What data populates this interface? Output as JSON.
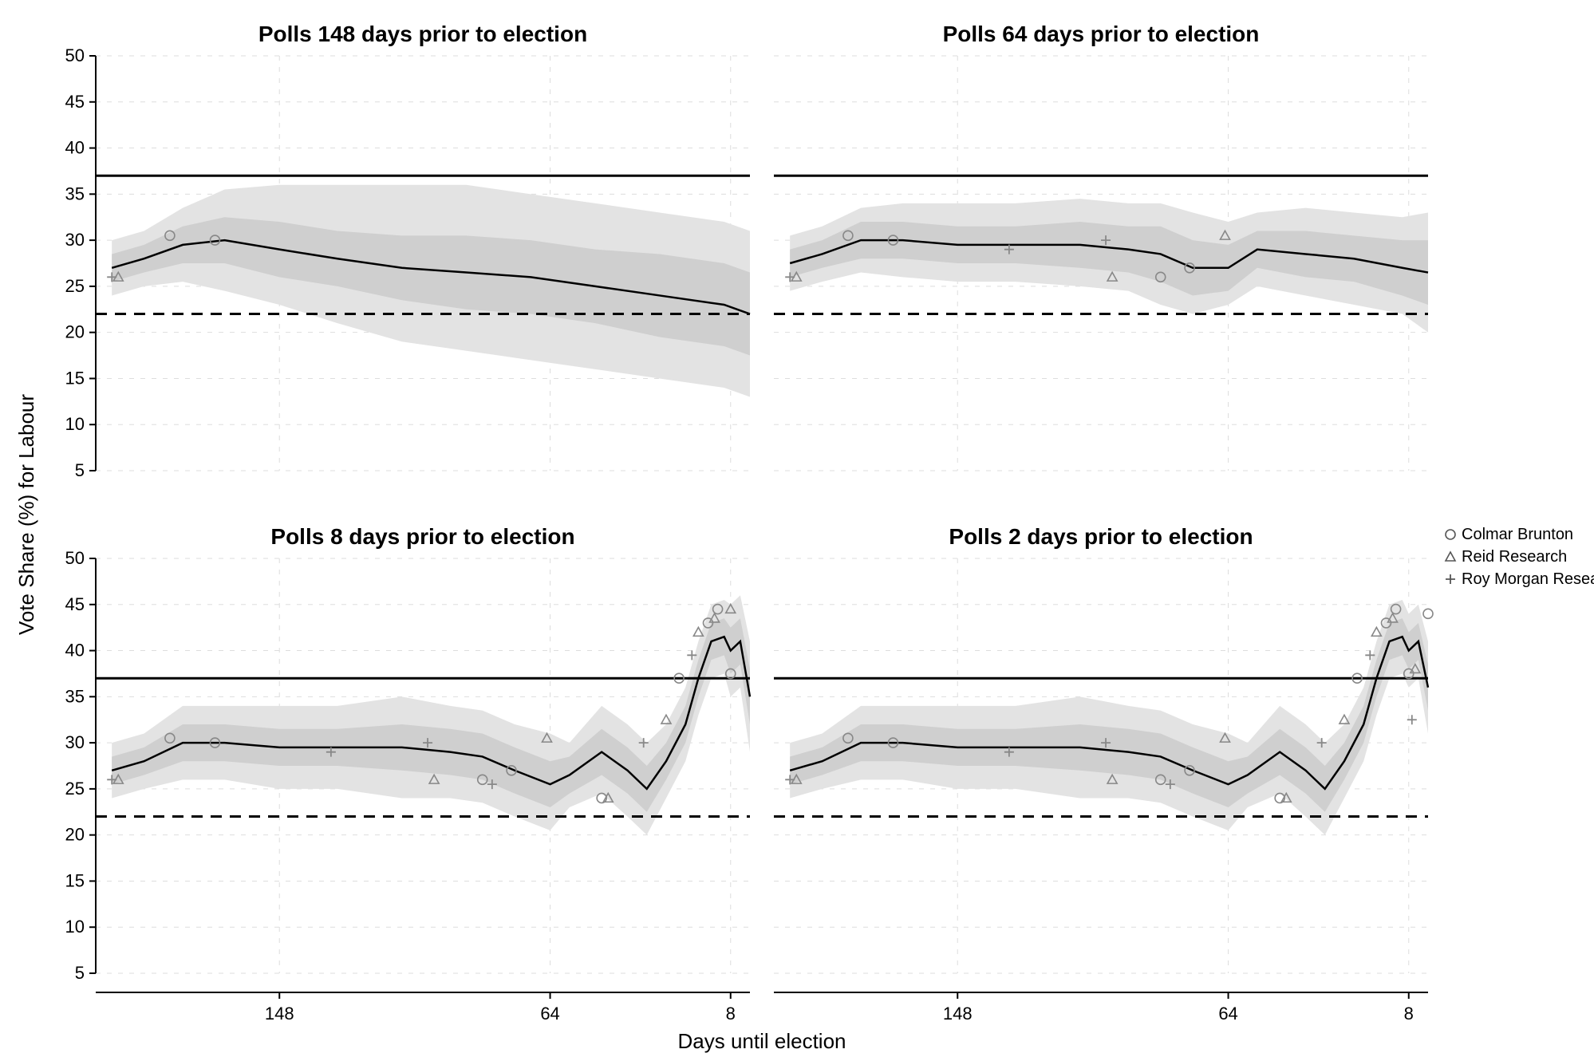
{
  "chart_data": {
    "type": "line",
    "ylabel": "Vote Share (%) for Labour",
    "xlabel": "Days until election",
    "y_ticks": [
      5,
      10,
      15,
      20,
      25,
      30,
      35,
      40,
      45,
      50
    ],
    "x_ticks": [
      148,
      64,
      8
    ],
    "ylim": [
      5,
      50
    ],
    "ref_lines": {
      "solid": 37,
      "dashed": 22
    },
    "legend": {
      "items": [
        "Colmar Brunton",
        "Reid Research",
        "Roy Morgan Research"
      ],
      "symbols": [
        "circle",
        "triangle",
        "plus"
      ]
    },
    "panels": [
      {
        "title": "Polls 148 days prior to election",
        "series": {
          "x": [
            200,
            190,
            178,
            165,
            148,
            130,
            110,
            90,
            70,
            50,
            30,
            10,
            2
          ],
          "mean": [
            27,
            28,
            29.5,
            30,
            29,
            28,
            27,
            26.5,
            26,
            25,
            24,
            23,
            22
          ],
          "lo50": [
            25.5,
            26.5,
            27.5,
            27.5,
            26,
            25,
            23.5,
            22.5,
            22,
            21,
            19.5,
            18.5,
            17.5
          ],
          "hi50": [
            28.5,
            29.5,
            31.5,
            32.5,
            32,
            31,
            30.5,
            30.5,
            30,
            29,
            28.5,
            27.5,
            26.5
          ],
          "lo90": [
            24,
            25,
            25.5,
            24.5,
            23,
            21,
            19,
            18,
            17,
            16,
            15,
            14,
            13
          ],
          "hi90": [
            30,
            31,
            33.5,
            35.5,
            36,
            36,
            36,
            36,
            35,
            34,
            33,
            32,
            31
          ]
        },
        "points": [
          {
            "sym": "plus",
            "x": 200,
            "y": 26
          },
          {
            "sym": "triangle",
            "x": 198,
            "y": 26
          },
          {
            "sym": "circle",
            "x": 182,
            "y": 30.5
          },
          {
            "sym": "circle",
            "x": 168,
            "y": 30
          }
        ]
      },
      {
        "title": "Polls 64 days prior to election",
        "series": {
          "x": [
            200,
            190,
            178,
            165,
            148,
            130,
            110,
            95,
            85,
            75,
            64,
            55,
            40,
            25,
            10,
            2
          ],
          "mean": [
            27.5,
            28.5,
            30,
            30,
            29.5,
            29.5,
            29.5,
            29,
            28.5,
            27,
            27,
            29,
            28.5,
            28,
            27,
            26.5
          ],
          "lo50": [
            26,
            27,
            28,
            28,
            27.5,
            27.5,
            27,
            26.5,
            25.5,
            24,
            24.5,
            27,
            26,
            25.5,
            24,
            23
          ],
          "hi50": [
            29,
            30,
            32,
            32,
            31.5,
            31.5,
            32,
            31.5,
            31.5,
            30,
            29.5,
            31,
            31,
            30.5,
            30,
            30
          ],
          "lo90": [
            24.5,
            25.5,
            26.5,
            26,
            25.5,
            25.5,
            25,
            24.5,
            23,
            22,
            23,
            25,
            24,
            23,
            22,
            20
          ],
          "hi90": [
            30.5,
            31.5,
            33.5,
            34,
            34,
            34,
            34.5,
            34,
            34,
            33,
            32,
            33,
            33.5,
            33,
            32.5,
            33
          ]
        },
        "points": [
          {
            "sym": "plus",
            "x": 200,
            "y": 26
          },
          {
            "sym": "triangle",
            "x": 198,
            "y": 26
          },
          {
            "sym": "circle",
            "x": 182,
            "y": 30.5
          },
          {
            "sym": "circle",
            "x": 168,
            "y": 30
          },
          {
            "sym": "plus",
            "x": 132,
            "y": 29
          },
          {
            "sym": "plus",
            "x": 102,
            "y": 30
          },
          {
            "sym": "triangle",
            "x": 100,
            "y": 26
          },
          {
            "sym": "circle",
            "x": 85,
            "y": 26
          },
          {
            "sym": "circle",
            "x": 76,
            "y": 27
          },
          {
            "sym": "triangle",
            "x": 65,
            "y": 30.5
          }
        ]
      },
      {
        "title": "Polls 8 days prior to election",
        "series": {
          "x": [
            200,
            190,
            178,
            165,
            148,
            130,
            110,
            95,
            85,
            75,
            64,
            58,
            48,
            40,
            34,
            28,
            22,
            18,
            14,
            10,
            8,
            5,
            2
          ],
          "mean": [
            27,
            28,
            30,
            30,
            29.5,
            29.5,
            29.5,
            29,
            28.5,
            27,
            25.5,
            26.5,
            29,
            27,
            25,
            28,
            32,
            37,
            41,
            41.5,
            40,
            41,
            35
          ],
          "lo50": [
            25.5,
            26.5,
            28,
            28,
            27.5,
            27.5,
            27,
            26.5,
            26,
            24.5,
            23,
            24.5,
            26.5,
            24.5,
            22.5,
            26,
            30,
            35,
            39,
            39.5,
            37.5,
            38.5,
            32
          ],
          "hi50": [
            28.5,
            29.5,
            32,
            32,
            31.5,
            31.5,
            32,
            31.5,
            31,
            29.5,
            28,
            28.5,
            31.5,
            29.5,
            27.5,
            30,
            34,
            39,
            43,
            43.5,
            42.5,
            43.5,
            38
          ],
          "lo90": [
            24,
            25,
            26,
            26,
            25,
            25,
            24,
            24,
            23.5,
            22,
            20.5,
            23,
            24.5,
            22,
            20,
            24,
            28,
            33,
            37,
            37.5,
            35,
            36,
            29
          ],
          "hi90": [
            30,
            31,
            34,
            34,
            34,
            34,
            35,
            34,
            33.5,
            32,
            31,
            30,
            34,
            32,
            30,
            32,
            36,
            41,
            45,
            45.5,
            45,
            46,
            41
          ]
        },
        "points": [
          {
            "sym": "plus",
            "x": 200,
            "y": 26
          },
          {
            "sym": "triangle",
            "x": 198,
            "y": 26
          },
          {
            "sym": "circle",
            "x": 182,
            "y": 30.5
          },
          {
            "sym": "circle",
            "x": 168,
            "y": 30
          },
          {
            "sym": "plus",
            "x": 132,
            "y": 29
          },
          {
            "sym": "plus",
            "x": 102,
            "y": 30
          },
          {
            "sym": "triangle",
            "x": 100,
            "y": 26
          },
          {
            "sym": "circle",
            "x": 85,
            "y": 26
          },
          {
            "sym": "plus",
            "x": 82,
            "y": 25.5
          },
          {
            "sym": "circle",
            "x": 76,
            "y": 27
          },
          {
            "sym": "triangle",
            "x": 65,
            "y": 30.5
          },
          {
            "sym": "circle",
            "x": 48,
            "y": 24
          },
          {
            "sym": "triangle",
            "x": 46,
            "y": 24
          },
          {
            "sym": "plus",
            "x": 35,
            "y": 30
          },
          {
            "sym": "triangle",
            "x": 28,
            "y": 32.5
          },
          {
            "sym": "circle",
            "x": 24,
            "y": 37
          },
          {
            "sym": "plus",
            "x": 20,
            "y": 39.5
          },
          {
            "sym": "triangle",
            "x": 18,
            "y": 42
          },
          {
            "sym": "circle",
            "x": 15,
            "y": 43
          },
          {
            "sym": "triangle",
            "x": 13,
            "y": 43.5
          },
          {
            "sym": "circle",
            "x": 12,
            "y": 44.5
          },
          {
            "sym": "circle",
            "x": 8,
            "y": 37.5
          },
          {
            "sym": "triangle",
            "x": 8,
            "y": 44.5
          }
        ]
      },
      {
        "title": "Polls 2 days prior to election",
        "series": {
          "x": [
            200,
            190,
            178,
            165,
            148,
            130,
            110,
            95,
            85,
            75,
            64,
            58,
            48,
            40,
            34,
            28,
            22,
            18,
            14,
            10,
            8,
            5,
            2
          ],
          "mean": [
            27,
            28,
            30,
            30,
            29.5,
            29.5,
            29.5,
            29,
            28.5,
            27,
            25.5,
            26.5,
            29,
            27,
            25,
            28,
            32,
            37,
            41,
            41.5,
            40,
            41,
            36
          ],
          "lo50": [
            25.5,
            26.5,
            28,
            28,
            27.5,
            27.5,
            27,
            26.5,
            26,
            24.5,
            23,
            24.5,
            26.5,
            24.5,
            22.5,
            26,
            30,
            35,
            39,
            39.5,
            38,
            39,
            33.5
          ],
          "hi50": [
            28.5,
            29.5,
            32,
            32,
            31.5,
            31.5,
            32,
            31.5,
            31,
            29.5,
            28,
            28.5,
            31.5,
            29.5,
            27.5,
            30,
            34,
            39,
            43,
            43.5,
            42,
            43,
            38.5
          ],
          "lo90": [
            24,
            25,
            26,
            26,
            25,
            25,
            24,
            24,
            23.5,
            22,
            20.5,
            23,
            24.5,
            22,
            20,
            24,
            28,
            33,
            37,
            37.5,
            36,
            37,
            31
          ],
          "hi90": [
            30,
            31,
            34,
            34,
            34,
            34,
            35,
            34,
            33.5,
            32,
            31,
            30,
            34,
            32,
            30,
            32,
            36,
            41,
            45,
            45.5,
            44,
            45,
            41
          ]
        },
        "points": [
          {
            "sym": "plus",
            "x": 200,
            "y": 26
          },
          {
            "sym": "triangle",
            "x": 198,
            "y": 26
          },
          {
            "sym": "circle",
            "x": 182,
            "y": 30.5
          },
          {
            "sym": "circle",
            "x": 168,
            "y": 30
          },
          {
            "sym": "plus",
            "x": 132,
            "y": 29
          },
          {
            "sym": "plus",
            "x": 102,
            "y": 30
          },
          {
            "sym": "triangle",
            "x": 100,
            "y": 26
          },
          {
            "sym": "circle",
            "x": 85,
            "y": 26
          },
          {
            "sym": "plus",
            "x": 82,
            "y": 25.5
          },
          {
            "sym": "circle",
            "x": 76,
            "y": 27
          },
          {
            "sym": "triangle",
            "x": 65,
            "y": 30.5
          },
          {
            "sym": "circle",
            "x": 48,
            "y": 24
          },
          {
            "sym": "triangle",
            "x": 46,
            "y": 24
          },
          {
            "sym": "plus",
            "x": 35,
            "y": 30
          },
          {
            "sym": "triangle",
            "x": 28,
            "y": 32.5
          },
          {
            "sym": "circle",
            "x": 24,
            "y": 37
          },
          {
            "sym": "plus",
            "x": 20,
            "y": 39.5
          },
          {
            "sym": "triangle",
            "x": 18,
            "y": 42
          },
          {
            "sym": "circle",
            "x": 15,
            "y": 43
          },
          {
            "sym": "triangle",
            "x": 13,
            "y": 43.5
          },
          {
            "sym": "circle",
            "x": 12,
            "y": 44.5
          },
          {
            "sym": "circle",
            "x": 8,
            "y": 37.5
          },
          {
            "sym": "plus",
            "x": 7,
            "y": 32.5
          },
          {
            "sym": "triangle",
            "x": 6,
            "y": 38
          },
          {
            "sym": "circle",
            "x": 2,
            "y": 44
          }
        ]
      }
    ]
  }
}
